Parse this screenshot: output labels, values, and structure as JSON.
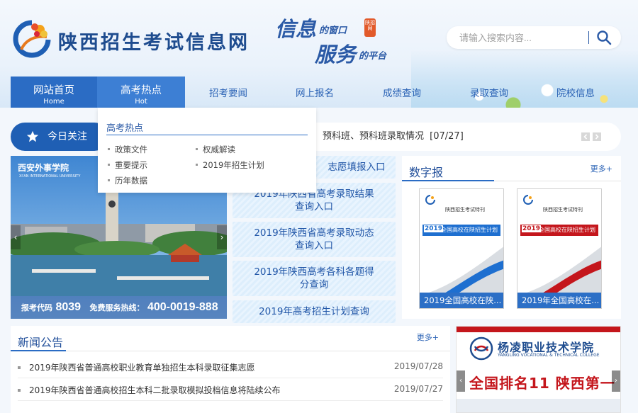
{
  "header": {
    "site_title": "陕西招生考试信息网",
    "slogan": {
      "line1_big": "信息",
      "line1_small": "的窗口",
      "line2_big": "服务",
      "line2_small": "的平台",
      "seal": "陕招网"
    }
  },
  "search": {
    "placeholder": "请输入搜索内容..."
  },
  "nav": {
    "items": [
      {
        "label": "网站首页",
        "sub": "Home"
      },
      {
        "label": "高考热点",
        "sub": "Hot"
      },
      {
        "label": "招考要闻"
      },
      {
        "label": "网上报名"
      },
      {
        "label": "成绩查询"
      },
      {
        "label": "录取查询"
      },
      {
        "label": "院校信息"
      }
    ]
  },
  "dropdown": {
    "title": "高考热点",
    "items": [
      "政策文件",
      "权威解读",
      "重要提示",
      "2019年招生计划",
      "历年数据"
    ]
  },
  "today": {
    "label": "今日关注",
    "headline": "预科班、预科班录取情况",
    "date": "[07/27]"
  },
  "slider": {
    "school_name": "西安外事学院",
    "school_en": "XI'AN INTERNATIONAL UNIVERSITY",
    "code_label": "报考代码",
    "code": "8039",
    "hotline_label": "免费服务热线：",
    "hotline": "400-0019-888"
  },
  "quick_links": [
    {
      "text": "志愿填报入口"
    },
    {
      "line1": "2019年陕西省高考录取结果",
      "line2": "查询入口"
    },
    {
      "line1": "2019年陕西省高考录取动态",
      "line2": "查询入口"
    },
    {
      "line1": "2019年陕西高考各科各题得",
      "line2": "分查询"
    },
    {
      "text": "2019年高考招生计划查询"
    }
  ],
  "digital": {
    "title": "数字报",
    "more": "更多+",
    "papers": [
      {
        "masthead": "陕西招生考试特刊",
        "headline": "全国高校在陕招生计划",
        "year": "2019",
        "caption": "2019全国高校在陕...",
        "accent": "#1e6fd0"
      },
      {
        "masthead": "陕西招生考试特刊",
        "headline": "全国高校在陕招生计划",
        "year": "2019",
        "caption": "2019年全国高校在...",
        "accent": "#c4161c"
      }
    ]
  },
  "news": {
    "title": "新闻公告",
    "more": "更多+",
    "items": [
      {
        "title": "2019年陕西省普通高校职业教育单独招生本科录取征集志愿",
        "date": "2019/07/28"
      },
      {
        "title": "2019年陕西省普通高校招生本科二批录取模拟投档信息将陆续公布",
        "date": "2019/07/27"
      }
    ]
  },
  "ad": {
    "name": "杨凌职业技术学院",
    "name_en": "YANGLING VOCATIONAL & TECHNICAL COLLEGE",
    "slogan": "全国排名11 陕西第一"
  }
}
